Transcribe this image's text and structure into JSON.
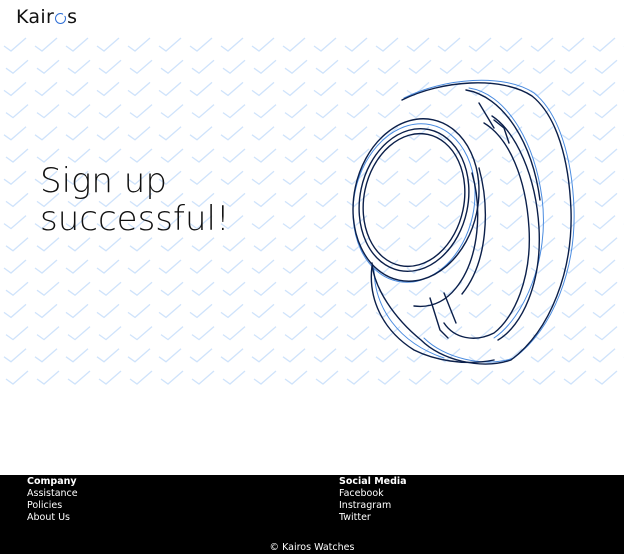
{
  "header": {
    "logo_text": "Kairos",
    "logo_prefix": "Kair",
    "logo_suffix": "s",
    "accent_color": "#2f6fd6"
  },
  "hero": {
    "headline_line1": "Sign up",
    "headline_line2": "successful!",
    "pattern_icon": "checkmark-icon",
    "pattern_color": "#cfe3fb",
    "illustration": "smartwatch-icon"
  },
  "footer": {
    "company": {
      "title": "Company",
      "links": [
        "Assistance",
        "Policies",
        "About Us"
      ]
    },
    "social": {
      "title": "Social Media",
      "links": [
        "Facebook",
        "Instragram",
        "Twitter"
      ]
    },
    "copyright": "© Kairos Watches",
    "background": "#000000"
  }
}
